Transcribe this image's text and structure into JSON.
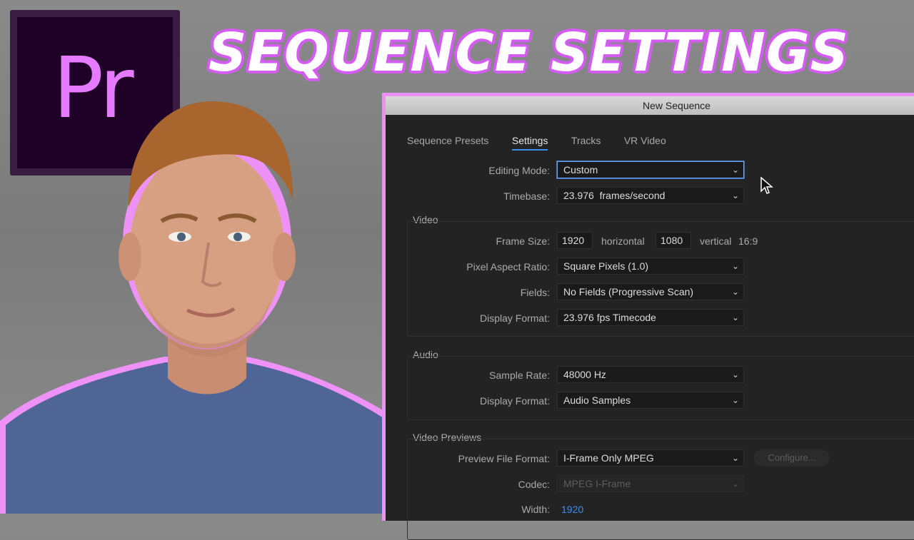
{
  "logo": {
    "text": "Pr"
  },
  "headline": "SEQUENCE SETTINGS",
  "dialog": {
    "title": "New Sequence",
    "tabs": [
      "Sequence Presets",
      "Settings",
      "Tracks",
      "VR Video"
    ],
    "active_tab": "Settings",
    "editing_mode": {
      "label": "Editing Mode:",
      "value": "Custom"
    },
    "timebase": {
      "label": "Timebase:",
      "value": "23.976  frames/second"
    },
    "video": {
      "section": "Video",
      "frame_size_label": "Frame Size:",
      "width": "1920",
      "horizontal": "horizontal",
      "height": "1080",
      "vertical": "vertical",
      "aspect": "16:9",
      "par": {
        "label": "Pixel Aspect Ratio:",
        "value": "Square Pixels (1.0)"
      },
      "fields": {
        "label": "Fields:",
        "value": "No Fields (Progressive Scan)"
      },
      "display_format": {
        "label": "Display Format:",
        "value": "23.976 fps Timecode"
      }
    },
    "audio": {
      "section": "Audio",
      "sample_rate": {
        "label": "Sample Rate:",
        "value": "48000 Hz"
      },
      "display_format": {
        "label": "Display Format:",
        "value": "Audio Samples"
      }
    },
    "previews": {
      "section": "Video Previews",
      "preview_format": {
        "label": "Preview File Format:",
        "value": "I-Frame Only MPEG"
      },
      "configure": "Configure...",
      "codec": {
        "label": "Codec:",
        "value": "MPEG I-Frame"
      },
      "width": {
        "label": "Width:",
        "value": "1920"
      }
    }
  },
  "colors": {
    "accent": "#d55cf2",
    "logo_bg": "#1f0026",
    "dialog_bg": "#232323",
    "link_blue": "#3c8ef0"
  }
}
